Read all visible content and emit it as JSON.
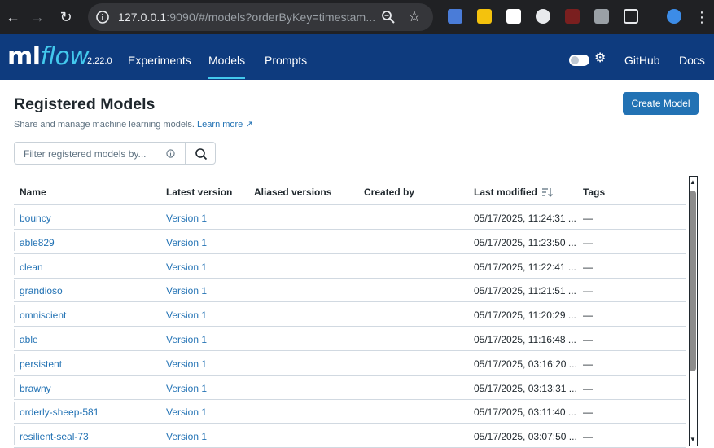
{
  "browser": {
    "url_host": "127.0.0.1",
    "url_rest": ":9090/#/models?orderByKey=timestam..."
  },
  "header": {
    "logo_ml": "ml",
    "logo_flow": "flow",
    "version": "2.22.0",
    "nav": [
      "Experiments",
      "Models",
      "Prompts"
    ],
    "active_nav": "Models",
    "right_links": [
      "GitHub",
      "Docs"
    ]
  },
  "page": {
    "title": "Registered Models",
    "subtitle": "Share and manage machine learning models.",
    "learn_more": "Learn more",
    "create_button": "Create Model",
    "search_placeholder": "Filter registered models by..."
  },
  "table": {
    "columns": [
      "Name",
      "Latest version",
      "Aliased versions",
      "Created by",
      "Last modified",
      "Tags"
    ],
    "rows": [
      {
        "name": "bouncy",
        "version": "Version 1",
        "modified": "05/17/2025, 11:24:31 ...",
        "tags": "—"
      },
      {
        "name": "able829",
        "version": "Version 1",
        "modified": "05/17/2025, 11:23:50 ...",
        "tags": "—"
      },
      {
        "name": "clean",
        "version": "Version 1",
        "modified": "05/17/2025, 11:22:41 ...",
        "tags": "—"
      },
      {
        "name": "grandioso",
        "version": "Version 1",
        "modified": "05/17/2025, 11:21:51 ...",
        "tags": "—"
      },
      {
        "name": "omniscient",
        "version": "Version 1",
        "modified": "05/17/2025, 11:20:29 ...",
        "tags": "—"
      },
      {
        "name": "able",
        "version": "Version 1",
        "modified": "05/17/2025, 11:16:48 ...",
        "tags": "—"
      },
      {
        "name": "persistent",
        "version": "Version 1",
        "modified": "05/17/2025, 03:16:20 ...",
        "tags": "—"
      },
      {
        "name": "brawny",
        "version": "Version 1",
        "modified": "05/17/2025, 03:13:31 ...",
        "tags": "—"
      },
      {
        "name": "orderly-sheep-581",
        "version": "Version 1",
        "modified": "05/17/2025, 03:11:40 ...",
        "tags": "—"
      },
      {
        "name": "resilient-seal-73",
        "version": "Version 1",
        "modified": "05/17/2025, 03:07:50 ...",
        "tags": "—"
      }
    ]
  },
  "colors": {
    "header_bg": "#0e3b7e",
    "accent": "#43c9ed",
    "link": "#2272b4",
    "primary_button": "#2272b4"
  }
}
